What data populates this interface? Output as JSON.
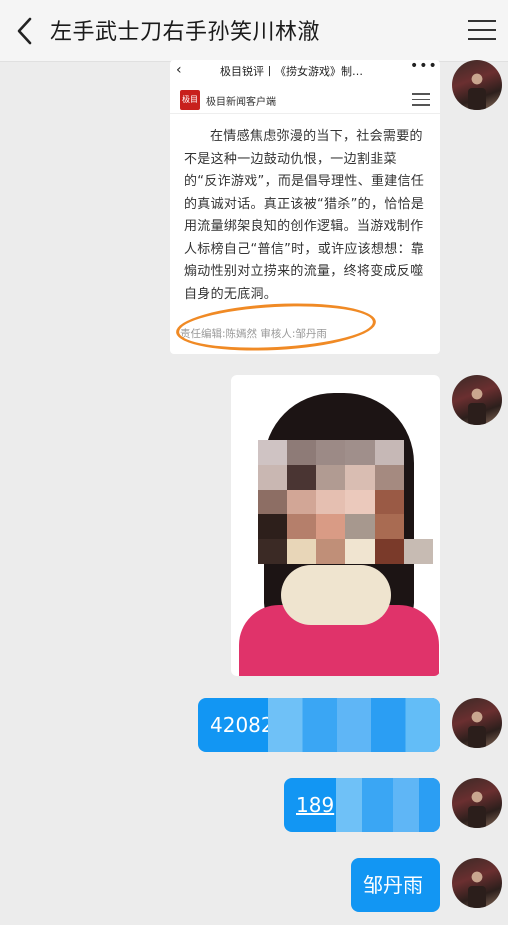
{
  "header": {
    "title": "左手武士刀右手孙笑川林澈",
    "back_icon": "chevron-left-icon",
    "menu_icon": "hamburger-menu-icon"
  },
  "article_card": {
    "top_title": "极目锐评丨《捞女游戏》制…",
    "more_icon": "more-dots-icon",
    "source_logo": "极目",
    "source_name": "极目新闻客户端",
    "body": "在情感焦虑弥漫的当下，社会需要的不是这种一边鼓动仇恨，一边割韭菜的“反诈游戏”，而是倡导理性、重建信任的真诚对话。真正该被“猎杀”的，恰恰是用流量绑架良知的创作逻辑。当游戏制作人标榜自己“普信”时，或许应该想想：靠煽动性别对立捞来的流量，终将变成反噬自身的无底洞。",
    "editors": "责任编辑:陈嫣然 审核人:邹丹雨",
    "highlight_color": "#f08a25"
  },
  "messages": [
    {
      "type": "image",
      "content": "pixelated-portrait-photo"
    },
    {
      "type": "text",
      "text": "42082"
    },
    {
      "type": "text",
      "text": "189"
    },
    {
      "type": "text",
      "text": "邹丹雨"
    }
  ],
  "colors": {
    "bubble": "#1296f3",
    "background": "#ececec",
    "logo_red": "#c8201c"
  }
}
